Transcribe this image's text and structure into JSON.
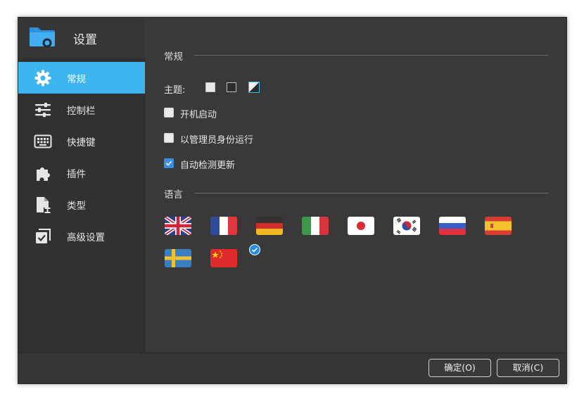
{
  "window": {
    "title": "设置"
  },
  "sidebar": {
    "items": [
      {
        "label": "常规",
        "icon": "gear-icon",
        "active": true
      },
      {
        "label": "控制栏",
        "icon": "sliders-icon",
        "active": false
      },
      {
        "label": "快捷键",
        "icon": "keyboard-icon",
        "active": false
      },
      {
        "label": "插件",
        "icon": "puzzle-icon",
        "active": false
      },
      {
        "label": "类型",
        "icon": "file-type-icon",
        "active": false
      },
      {
        "label": "高级设置",
        "icon": "checkbox-icon",
        "active": false
      }
    ]
  },
  "general": {
    "title": "常规",
    "theme_label": "主题:",
    "themes": [
      "light",
      "dark",
      "auto"
    ],
    "selected_theme": "auto",
    "options": [
      {
        "label": "开机启动",
        "checked": false
      },
      {
        "label": "以管理员身份运行",
        "checked": false
      },
      {
        "label": "自动检测更新",
        "checked": true
      }
    ]
  },
  "language": {
    "title": "语言",
    "flags": [
      "uk",
      "france",
      "germany",
      "italy",
      "japan",
      "korea",
      "russia",
      "spain",
      "sweden",
      "china"
    ],
    "selected": "china"
  },
  "footer": {
    "ok_label": "确定(O)",
    "cancel_label": "取消(C)"
  },
  "colors": {
    "accent": "#3cb5f0",
    "window_bg": "#393939",
    "sidebar_bg": "#313131",
    "check_blue": "#3a8fde"
  }
}
